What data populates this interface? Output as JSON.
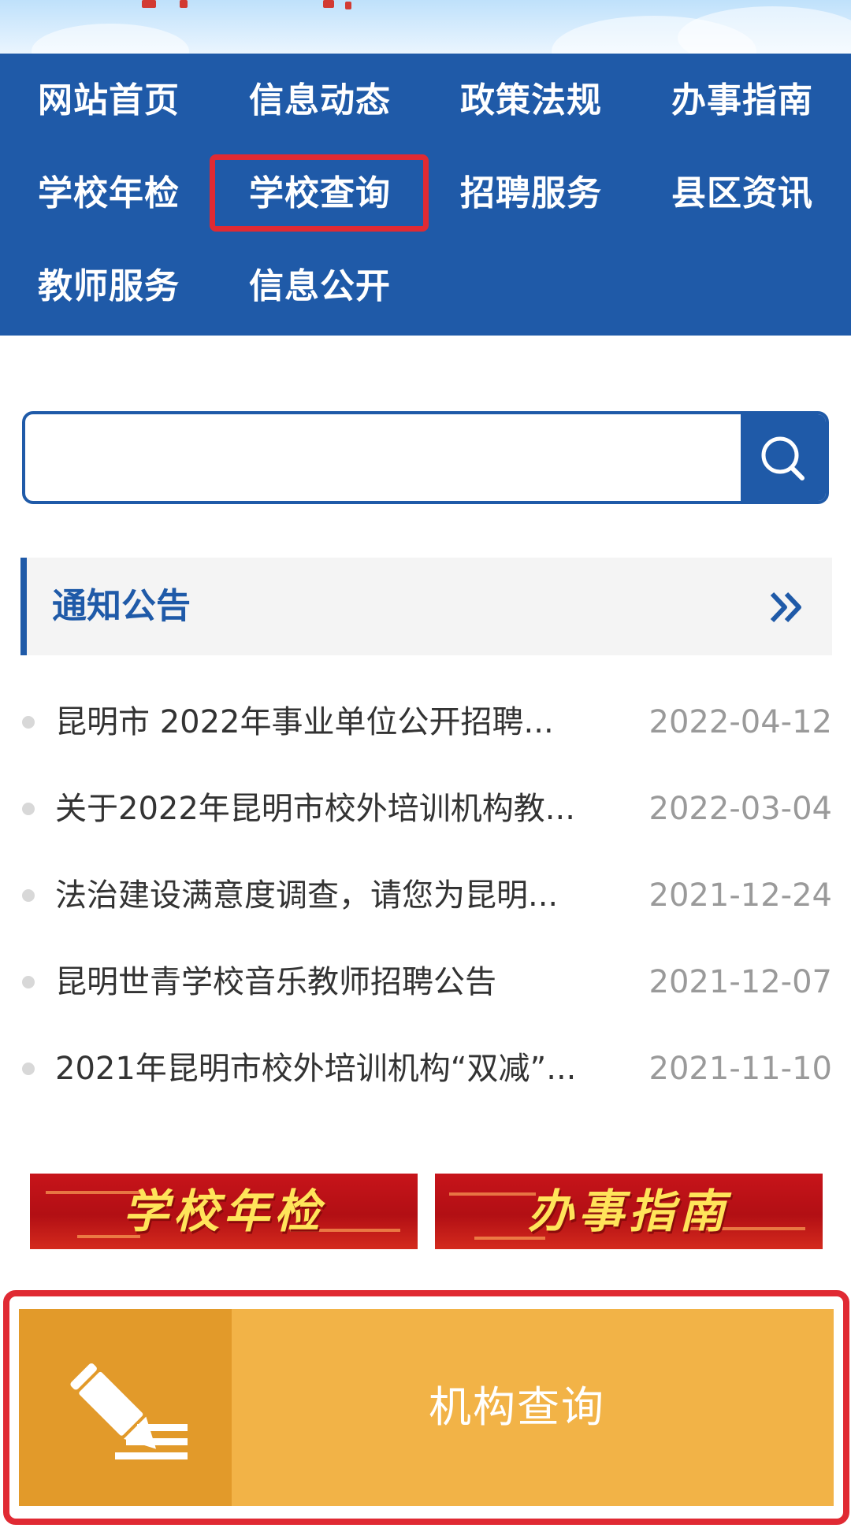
{
  "nav": {
    "items": [
      {
        "label": "网站首页"
      },
      {
        "label": "信息动态"
      },
      {
        "label": "政策法规"
      },
      {
        "label": "办事指南"
      },
      {
        "label": "学校年检"
      },
      {
        "label": "学校查询"
      },
      {
        "label": "招聘服务"
      },
      {
        "label": "县区资讯"
      },
      {
        "label": "教师服务"
      },
      {
        "label": "信息公开"
      }
    ],
    "highlighted": "学校查询"
  },
  "search": {
    "value": "",
    "placeholder": "",
    "button_icon": "search-icon"
  },
  "notices": {
    "title": "通知公告",
    "more_icon": "double-chevron-right-icon",
    "items": [
      {
        "title": "昆明市 2022年事业单位公开招聘...",
        "date": "2022-04-12"
      },
      {
        "title": "关于2022年昆明市校外培训机构教...",
        "date": "2022-03-04"
      },
      {
        "title": "法治建设满意度调查，请您为昆明...",
        "date": "2021-12-24"
      },
      {
        "title": "昆明世青学校音乐教师招聘公告",
        "date": "2021-12-07"
      },
      {
        "title": "2021年昆明市校外培训机构“双减”...",
        "date": "2021-11-10"
      }
    ]
  },
  "banners": [
    {
      "label": "学校年检"
    },
    {
      "label": "办事指南"
    }
  ],
  "query": {
    "label": "机构查询",
    "icon": "pencil-edit-icon"
  },
  "colors": {
    "primary": "#1f5aa8",
    "highlight": "#e02a33",
    "query_bg": "#f2b347",
    "query_icon_bg": "#e29a2a",
    "banner_red": "#c7141a",
    "banner_text": "#ffe45a"
  }
}
